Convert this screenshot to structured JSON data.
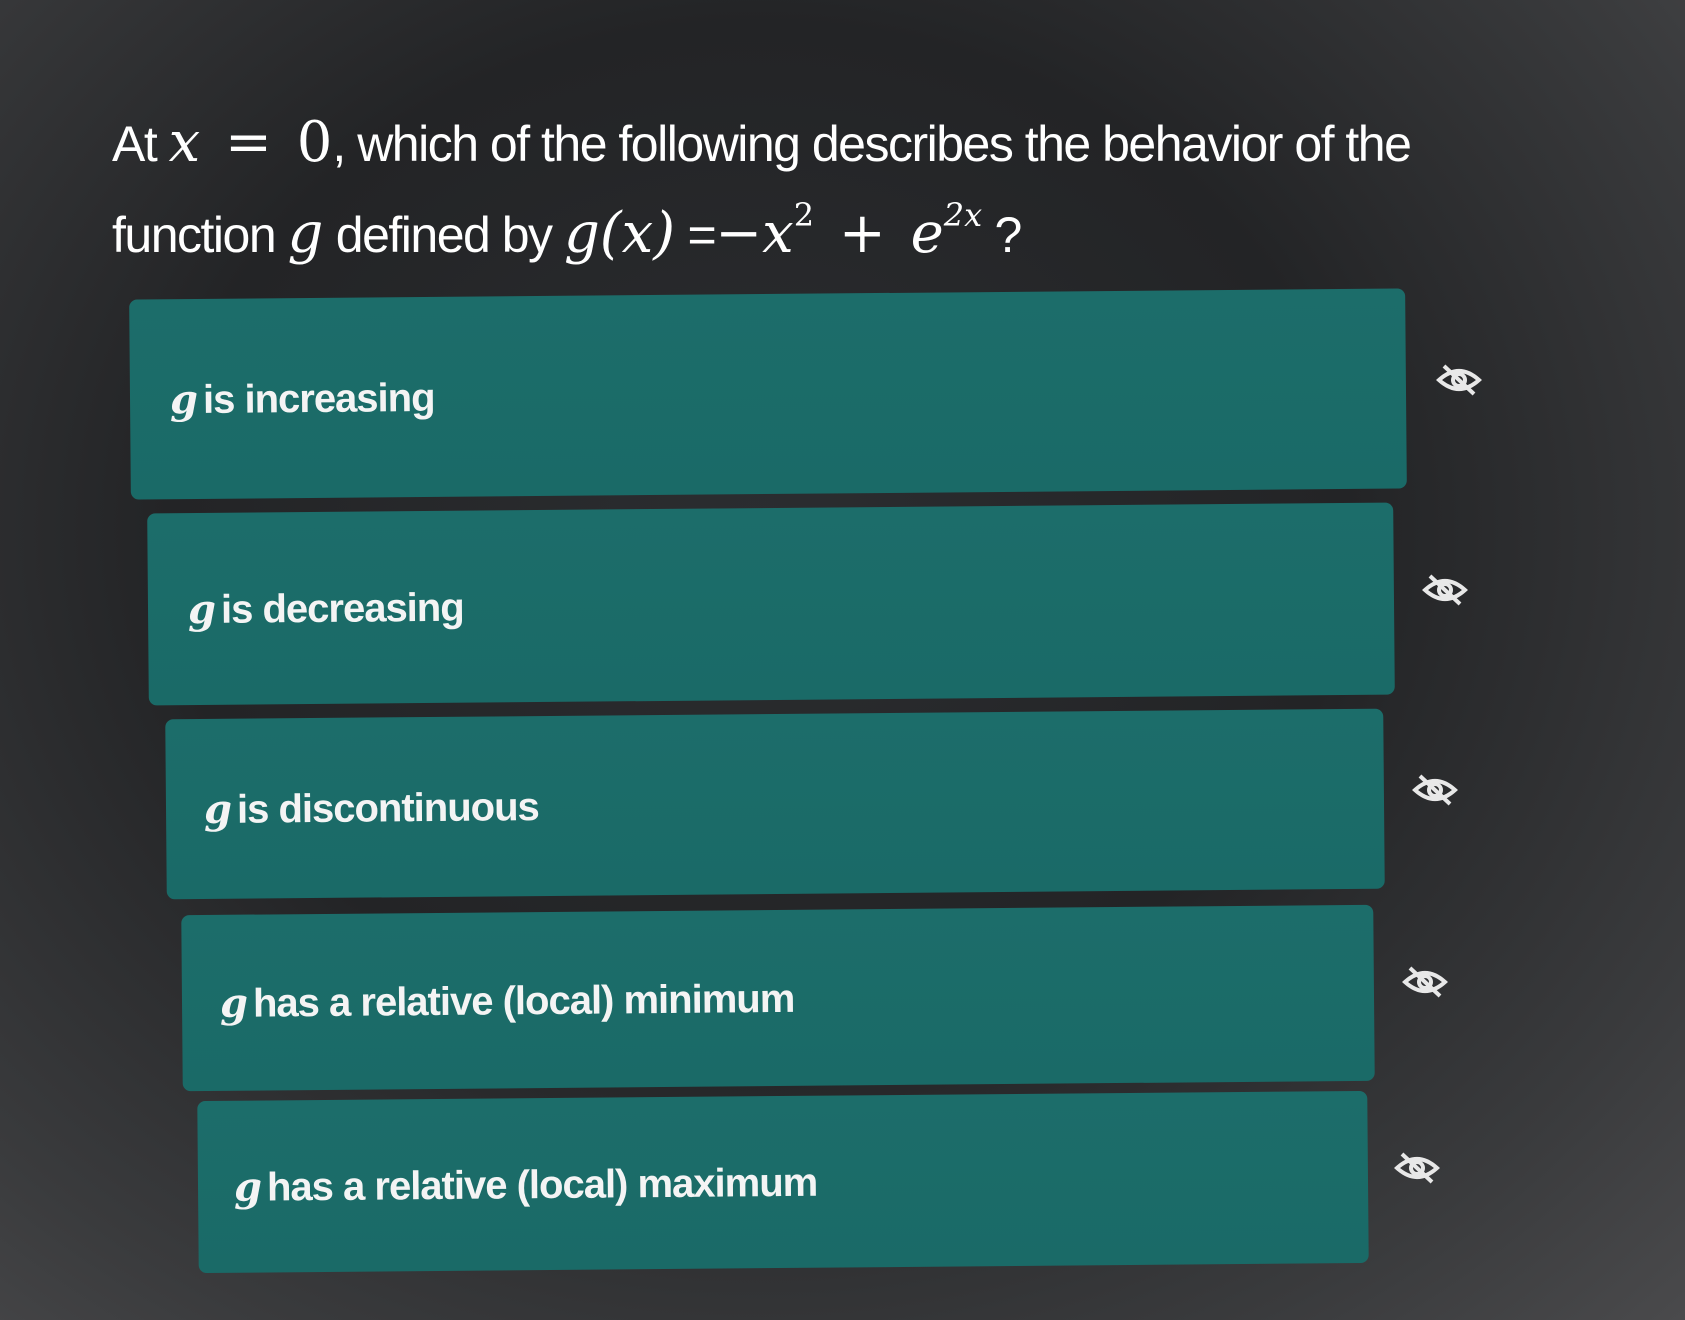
{
  "question": {
    "prefix": "At",
    "var_x": "x",
    "equals": "=",
    "zero": "0",
    "text_1": ", which of the following describes the behavior of the",
    "text_2": "function",
    "func_name": "g",
    "text_3": "defined by",
    "definition_lhs": "g(x)",
    "definition_eq": "=",
    "definition_rhs_a": "−x",
    "definition_rhs_a_exp": "2",
    "definition_plus": "+",
    "definition_rhs_b": "e",
    "definition_rhs_b_exp": "2x",
    "qmark": "?"
  },
  "options": [
    {
      "var": "g",
      "label": "is increasing"
    },
    {
      "var": "g",
      "label": "is decreasing"
    },
    {
      "var": "g",
      "label": "is discontinuous"
    },
    {
      "var": "g",
      "label": "has a relative (local) minimum"
    },
    {
      "var": "g",
      "label": "has a relative (local) maximum"
    }
  ],
  "icons": {
    "hide_option": "eye-slash-icon"
  },
  "colors": {
    "option_bg": "#1a6a67",
    "background": "#232426",
    "text": "#ffffff"
  }
}
